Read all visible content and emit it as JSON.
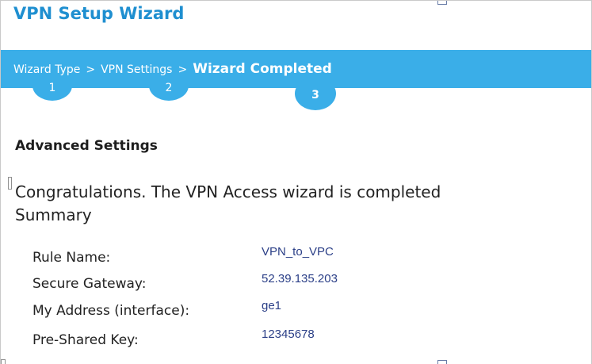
{
  "window": {
    "title": "VPN Setup Wizard"
  },
  "wizard": {
    "breadcrumbs": [
      {
        "label": "Wizard Type"
      },
      {
        "label": "VPN Settings"
      },
      {
        "label": "Wizard Completed"
      }
    ],
    "separator": ">",
    "steps": [
      "1",
      "2",
      "3"
    ],
    "current_step": 3,
    "accent_color": "#3aaee8",
    "title_color": "#1f8fd0"
  },
  "content": {
    "section_heading": "Advanced Settings",
    "message": "Congratulations. The VPN Access wizard is completed",
    "summary_label": "Summary",
    "summary": [
      {
        "label": "Rule Name:",
        "value": "VPN_to_VPC"
      },
      {
        "label": "Secure Gateway:",
        "value": "52.39.135.203"
      },
      {
        "label": "My Address (interface):",
        "value": "ge1"
      },
      {
        "label": "Pre-Shared Key:",
        "value": "12345678"
      }
    ]
  }
}
